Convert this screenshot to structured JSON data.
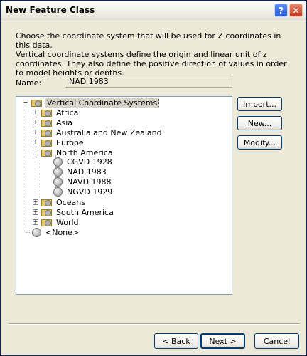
{
  "window": {
    "title": "New Feature Class",
    "help_glyph": "?",
    "close_glyph": "✕"
  },
  "description": {
    "line1": "Choose the coordinate system that will be used for Z coordinates in this data.",
    "line2": "Vertical coordinate systems define the origin and linear unit of z coordinates. They also define the positive direction of values in order to model heights or depths."
  },
  "name_field": {
    "label": "Name:",
    "value": "NAD 1983"
  },
  "tree": {
    "root": "Vertical Coordinate Systems",
    "folders": [
      "Africa",
      "Asia",
      "Australia and New Zealand",
      "Europe",
      "North America"
    ],
    "north_america_children": [
      "CGVD 1928",
      "NAD 1983",
      "NAVD 1988",
      "NGVD 1929"
    ],
    "more_folders": [
      "Oceans",
      "South America",
      "World"
    ],
    "none_item": "<None>"
  },
  "side_buttons": {
    "import": "Import...",
    "new": "New...",
    "modify": "Modify..."
  },
  "footer": {
    "back": "< Back",
    "next": "Next >",
    "cancel": "Cancel"
  },
  "colors": {
    "title_bar": "#f0efe6",
    "dialog_bg": "#ece9d8",
    "close_button": "#c0371b",
    "help_button": "#2558d8"
  }
}
